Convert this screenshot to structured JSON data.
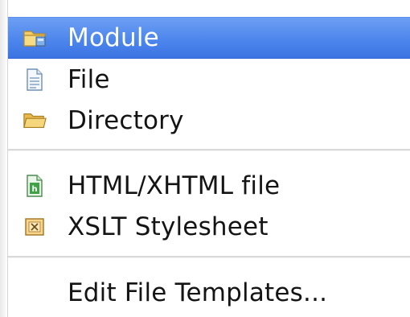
{
  "menu": {
    "items": [
      {
        "label": "Module",
        "icon": "module-folder-icon",
        "selected": true
      },
      {
        "label": "File",
        "icon": "file-icon",
        "selected": false
      },
      {
        "label": "Directory",
        "icon": "folder-icon",
        "selected": false
      },
      {
        "label": "HTML/XHTML file",
        "icon": "html-file-icon",
        "selected": false
      },
      {
        "label": "XSLT Stylesheet",
        "icon": "xslt-file-icon",
        "selected": false
      },
      {
        "label": "Edit File Templates...",
        "icon": "",
        "selected": false
      }
    ]
  },
  "colors": {
    "selection": "#4d86ec",
    "selected_text": "#ffffff",
    "text": "#141414",
    "separator": "#d9d9d9",
    "folder": "#f0c45a",
    "html_icon": "#3fa247",
    "xslt_icon": "#e8a13a"
  }
}
